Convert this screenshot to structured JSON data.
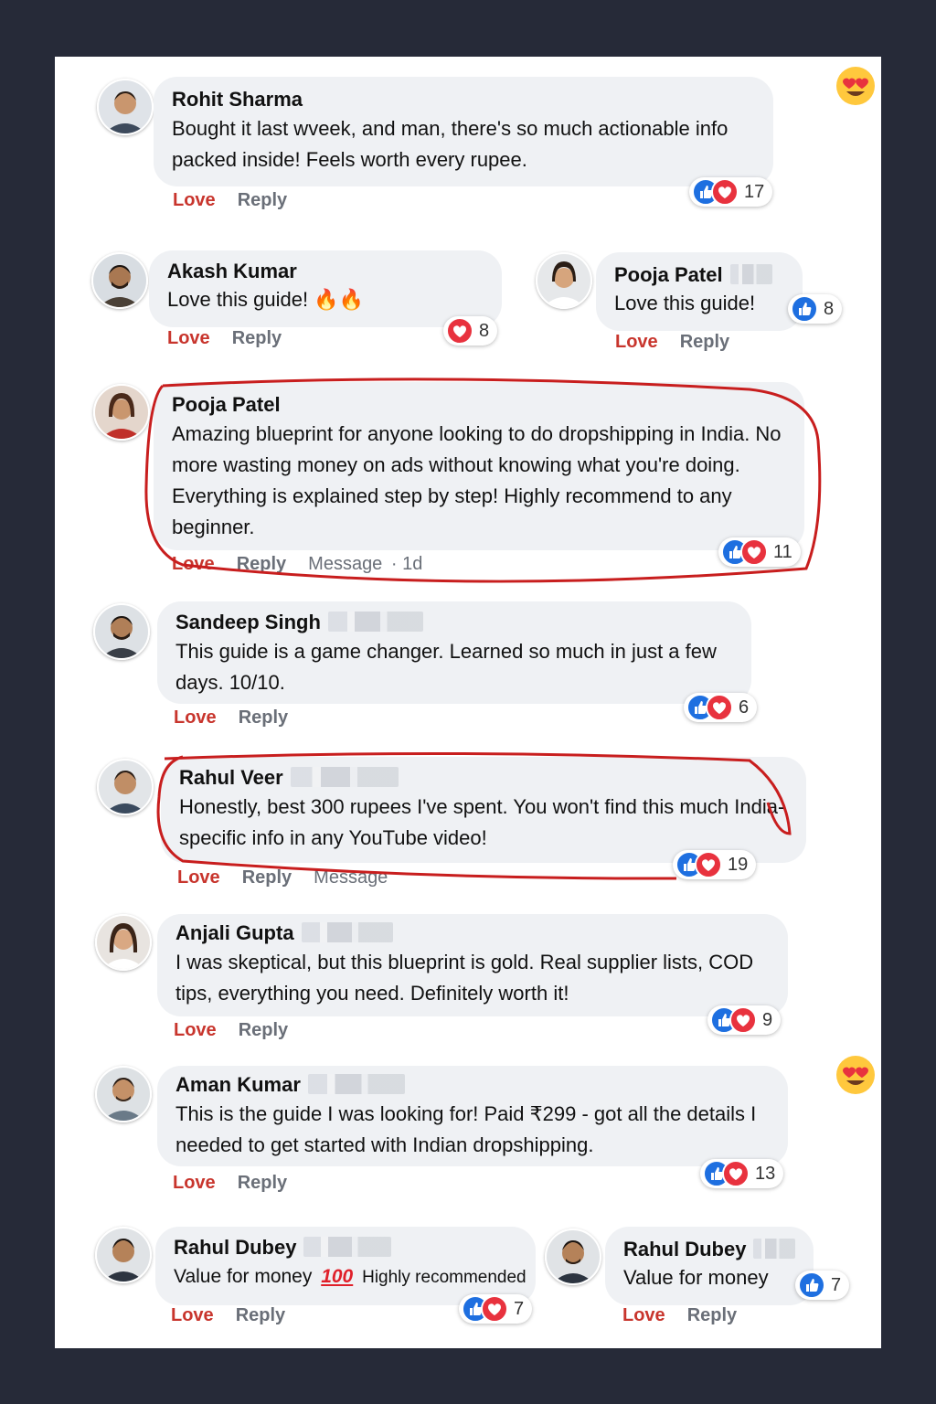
{
  "labels": {
    "love": "Love",
    "reply": "Reply",
    "message": "Message"
  },
  "colors": {
    "background": "#262a38",
    "bubble": "#eff1f4",
    "love": "#c8352d",
    "like": "#1e6fe0",
    "heart": "#e8323e",
    "highlight": "#c81e1e"
  },
  "comments": [
    {
      "name": "Rohit Sharma",
      "text": "Bought it last wveek, and man, there's so much actionable info packed inside! Feels worth every rupee.",
      "reactions": [
        "like-icon",
        "heart-icon"
      ],
      "count": "17"
    },
    {
      "name": "Akash Kumar",
      "text": "Love this guide! 🔥🔥",
      "reactions": [
        "heart-icon"
      ],
      "count": "8"
    },
    {
      "name": "Pooja Patel",
      "text": "Love this guide!",
      "reactions": [
        "like-icon"
      ],
      "count": "8"
    },
    {
      "name": "Pooja Patel",
      "text": "Amazing blueprint for anyone looking to do dropshipping in India. No more wasting money on ads without knowing what you're doing. Everything is explained step by step! Highly recommend to any beginner.",
      "reactions": [
        "like-icon",
        "heart-icon"
      ],
      "count": "11",
      "meta": "· 1d",
      "highlighted": true
    },
    {
      "name": "Sandeep Singh",
      "text": "This guide is a game changer. Learned so much in just a few days. 10/10.",
      "reactions": [
        "like-icon",
        "heart-icon"
      ],
      "count": "6"
    },
    {
      "name": "Rahul Veer",
      "text": "Honestly, best 300 rupees I've spent. You won't find this much India-specific info in any YouTube video!",
      "reactions": [
        "like-icon",
        "heart-icon"
      ],
      "count": "19",
      "highlighted": true
    },
    {
      "name": "Anjali Gupta",
      "text": "I was skeptical, but this blueprint is gold. Real supplier lists, COD tips, everything you need. Definitely worth it!",
      "reactions": [
        "like-icon",
        "heart-icon"
      ],
      "count": "9"
    },
    {
      "name": "Aman Kumar",
      "text": "This is the guide I was looking for! Paid ₹299 - got all the details I needed to get started with Indian dropshipping.",
      "reactions": [
        "like-icon",
        "heart-icon"
      ],
      "count": "13"
    },
    {
      "name": "Rahul Dubey",
      "text_before": "Value for money",
      "hundred": "100",
      "text_after": "Highly recommended",
      "reactions": [
        "like-icon",
        "heart-icon"
      ],
      "count": "7"
    },
    {
      "name": "Rahul Dubey",
      "text": "Value for money",
      "reactions": [
        "like-icon"
      ],
      "count": "7"
    }
  ],
  "decorations": [
    "heart-eyes-emoji",
    "heart-eyes-emoji"
  ]
}
